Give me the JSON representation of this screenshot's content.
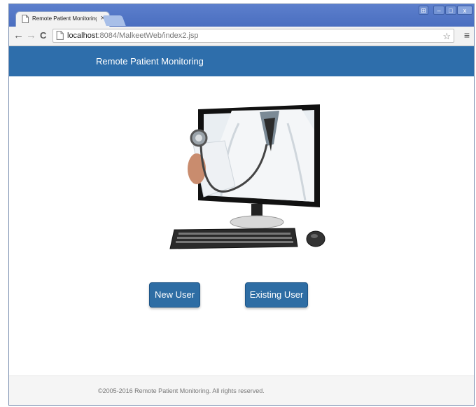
{
  "browser": {
    "tab_title": "Remote Patient Monitoring",
    "window_buttons": {
      "user": "⊞",
      "minimize": "–",
      "maximize": "□",
      "close": "x"
    },
    "nav": {
      "back": "←",
      "forward": "→",
      "reload": "C"
    },
    "url_host": "localhost",
    "url_rest": ":8084/MalkeetWeb/index2.jsp",
    "menu_icon": "≡",
    "star_icon": "☆"
  },
  "navbar": {
    "brand": "Remote Patient Monitoring"
  },
  "hero": {
    "image": "doctor-in-monitor-with-keyboard-and-mouse"
  },
  "actions": {
    "new_user": "New User",
    "existing_user": "Existing User"
  },
  "footer": {
    "copyright": "©2005-2016 Remote Patient Monitoring. All rights reserved."
  },
  "colors": {
    "navbar": "#2e6eab",
    "button": "#2e6da4",
    "titlebar": "#4a6ec0",
    "footer": "#f5f5f5"
  }
}
